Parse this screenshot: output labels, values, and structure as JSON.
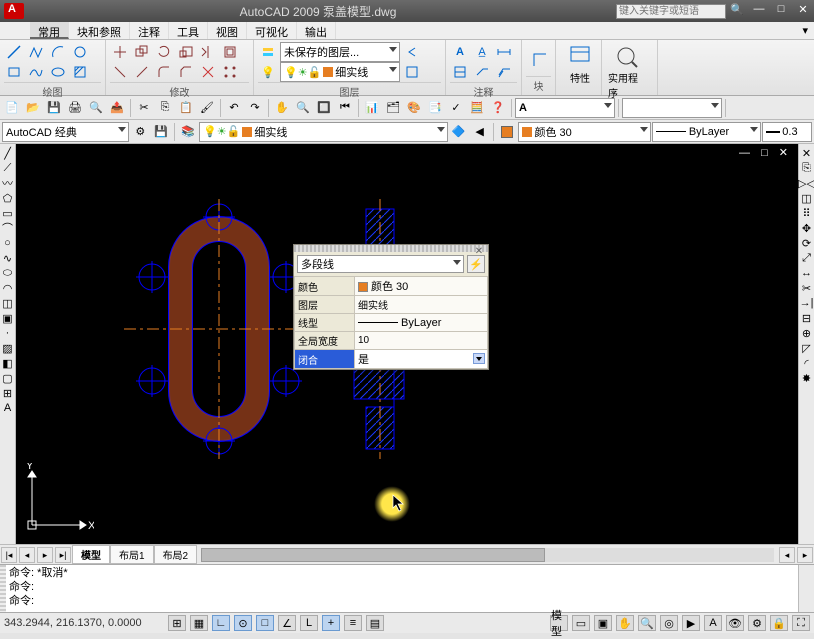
{
  "title": "AutoCAD 2009  泵盖模型.dwg",
  "search_placeholder": "键入关键字或短语",
  "tabs": {
    "t0": "常用",
    "t1": "块和参照",
    "t2": "注释",
    "t3": "工具",
    "t4": "视图",
    "t5": "可视化",
    "t6": "输出"
  },
  "panels": {
    "draw": "绘图",
    "modify": "修改",
    "layer": "图层",
    "annot": "注释",
    "block": "块",
    "props": "特性",
    "util": "实用程序"
  },
  "layer_presave": "未保存的图层...",
  "layer_combo": "细实线",
  "workspace": "AutoCAD 经典",
  "layer_current": "细实线",
  "color_current": "颜色 30",
  "lt_current": "ByLayer",
  "lw_current": "0.3",
  "palette": {
    "type": "多段线",
    "rows": {
      "color_k": "颜色",
      "color_v": "颜色 30",
      "layer_k": "图层",
      "layer_v": "细实线",
      "lt_k": "线型",
      "lt_v": "ByLayer",
      "gw_k": "全局宽度",
      "gw_v": "10",
      "close_k": "闭合",
      "close_v": "是"
    }
  },
  "modeltabs": {
    "m0": "模型",
    "m1": "布局1",
    "m2": "布局2"
  },
  "cmd": {
    "l0": "命令: *取消*",
    "l1": "命令:",
    "l2": "命令:"
  },
  "coords": "343.2944, 216.1370, 0.0000",
  "model_label": "模型"
}
